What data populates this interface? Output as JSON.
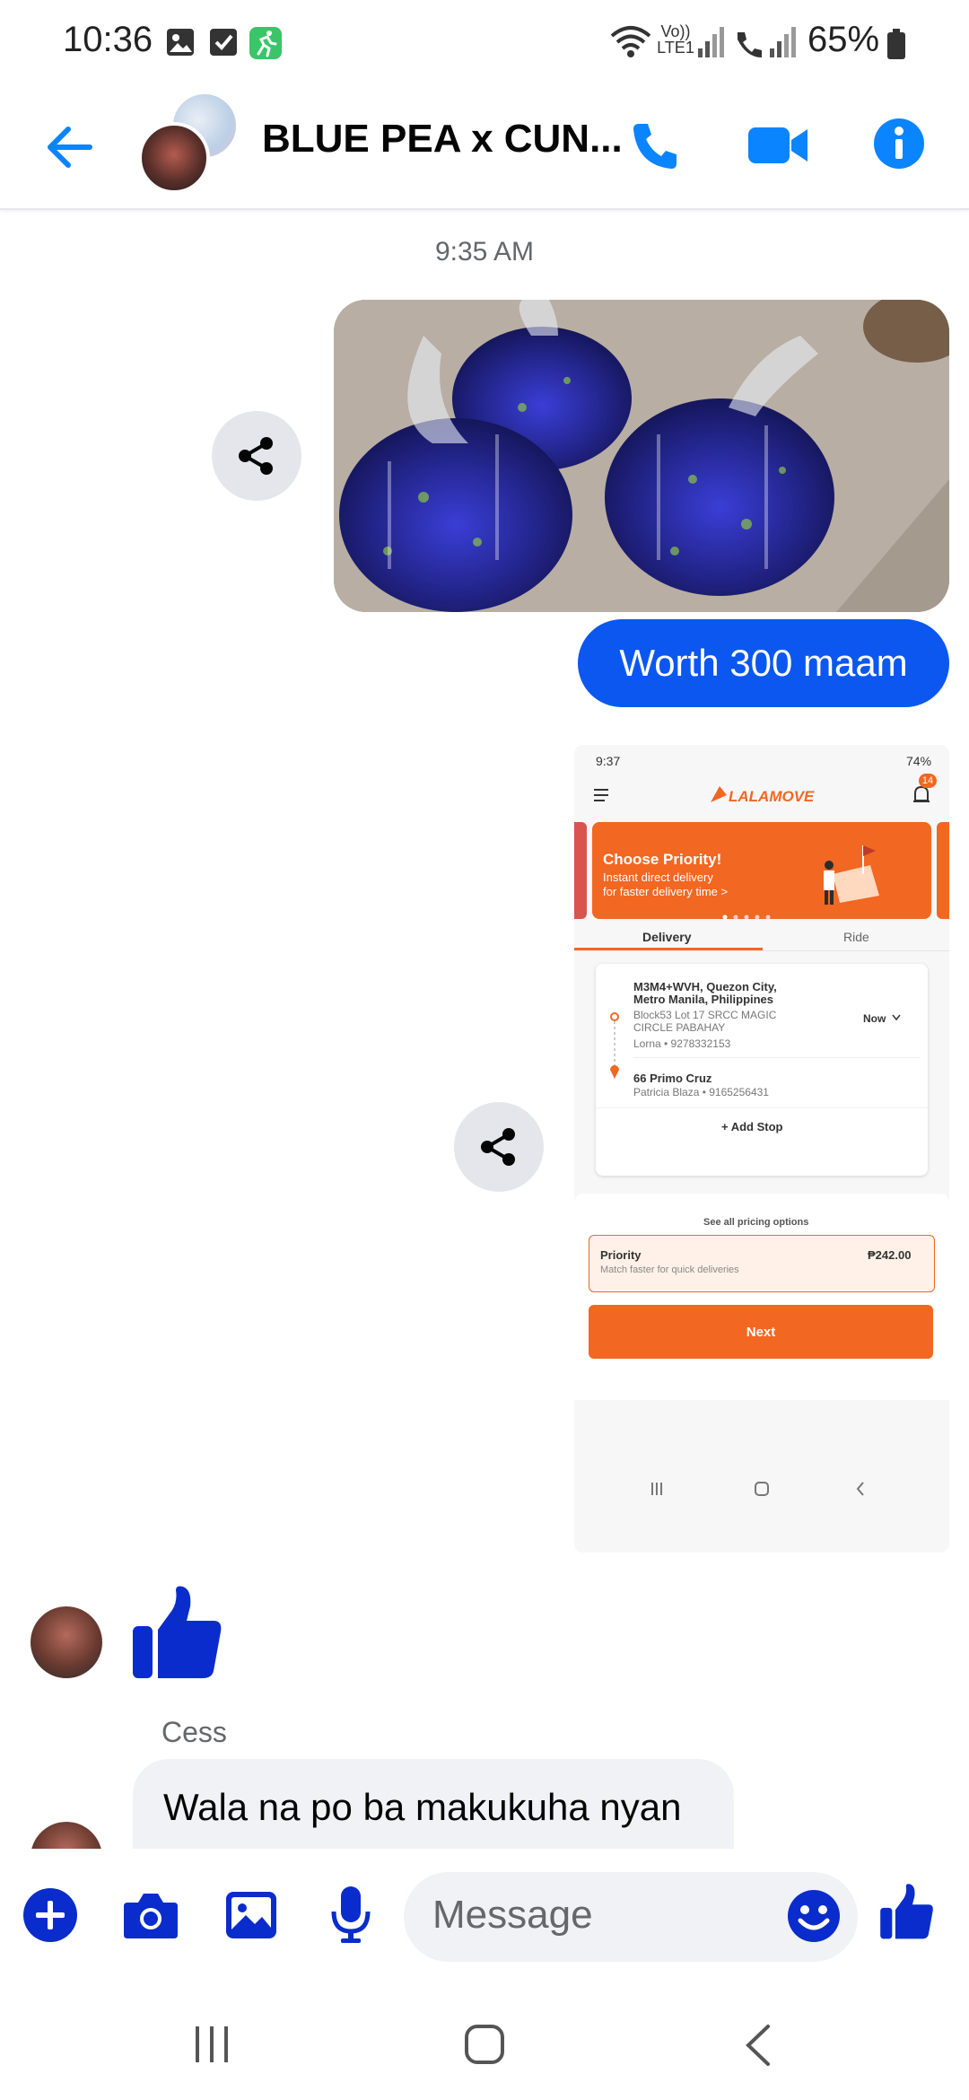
{
  "status_bar": {
    "time": "10:36",
    "battery": "65%",
    "signal_label": "Vo)) LTE1"
  },
  "header": {
    "title": "BLUE PEA x CUN...",
    "accent": "#0b84ff"
  },
  "messages": {
    "time_divider": "9:35 AM",
    "outgoing_text": "Worth 300 maam",
    "sender_name": "Cess",
    "incoming_text": "Wala na po ba makukuha nyan mam"
  },
  "shared_screenshot": {
    "time": "9:37",
    "battery": "74%",
    "brand": "LALAMOVE",
    "notification_count": "14",
    "banner_title": "Choose Priority!",
    "banner_sub": "Instant direct delivery for faster delivery time >",
    "tab_delivery": "Delivery",
    "tab_ride": "Ride",
    "pickup_line1": "M3M4+WVH, Quezon City,",
    "pickup_line2": "Metro Manila, Philippines",
    "pickup_detail1": "Block53 Lot 17 SRCC MAGIC",
    "pickup_detail2": "CIRCLE PABAHAY",
    "pickup_contact": "Lorna • 9278332153",
    "when": "Now",
    "dropoff": "66 Primo Cruz",
    "dropoff_contact": "Patricia Blaza • 9165256431",
    "add_stop": "+ Add Stop",
    "see_all": "See all pricing options",
    "priority_label": "Priority",
    "priority_sub": "Match faster for quick deliveries",
    "priority_price": "₱242.00",
    "next_label": "Next"
  },
  "composer": {
    "placeholder": "Message"
  },
  "colors": {
    "messenger_blue": "#0b57f0",
    "lalamove_orange": "#f26722"
  }
}
